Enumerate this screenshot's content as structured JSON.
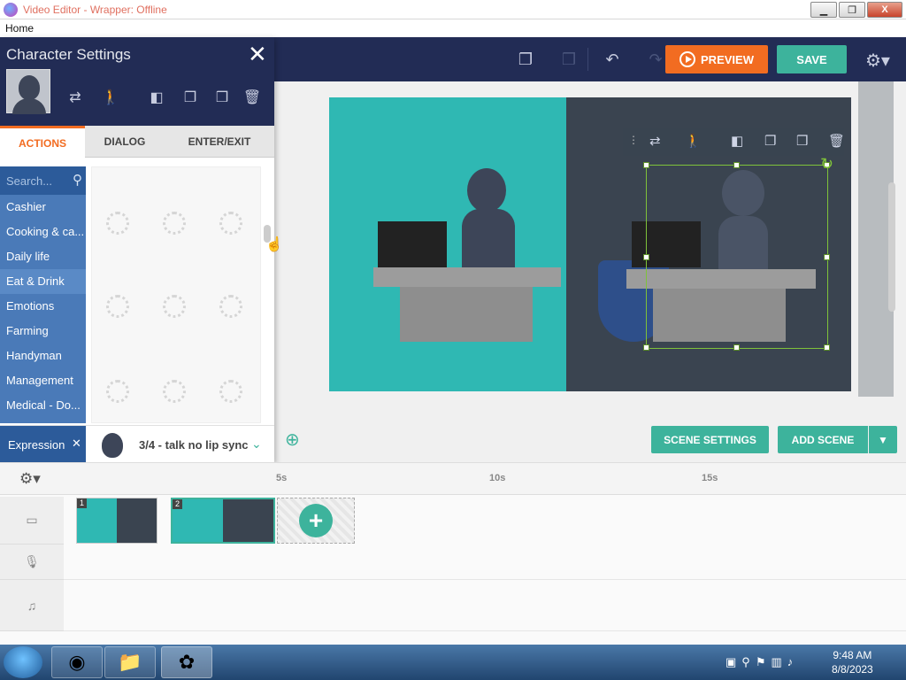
{
  "window": {
    "title": "Video Editor - Wrapper: Offline",
    "minimize": "▁",
    "maximize": "❐",
    "close": "X"
  },
  "menu": {
    "home": "Home"
  },
  "toolbar": {
    "preview_label": "PREVIEW",
    "save_label": "SAVE"
  },
  "character_panel": {
    "title": "Character Settings",
    "tabs": [
      {
        "label": "ACTIONS",
        "active": true
      },
      {
        "label": "DIALOG",
        "active": false
      },
      {
        "label": "ENTER/EXIT",
        "active": false
      }
    ],
    "search_placeholder": "Search...",
    "categories": [
      "Cashier",
      "Cooking & ca...",
      "Daily life",
      "Eat & Drink",
      "Emotions",
      "Farming",
      "Handyman",
      "Management",
      "Medical - Do..."
    ],
    "selected_category": "Eat & Drink",
    "expression": {
      "label": "Expression",
      "value": "3/4 - talk no lip sync"
    }
  },
  "stage_actions": {
    "scene_settings": "SCENE SETTINGS",
    "add_scene": "ADD SCENE"
  },
  "timeline": {
    "ticks": [
      "5s",
      "10s",
      "15s"
    ],
    "scenes": [
      {
        "number": "1"
      },
      {
        "number": "2"
      }
    ]
  },
  "taskbar": {
    "time": "9:48 AM",
    "date": "8/8/2023"
  }
}
